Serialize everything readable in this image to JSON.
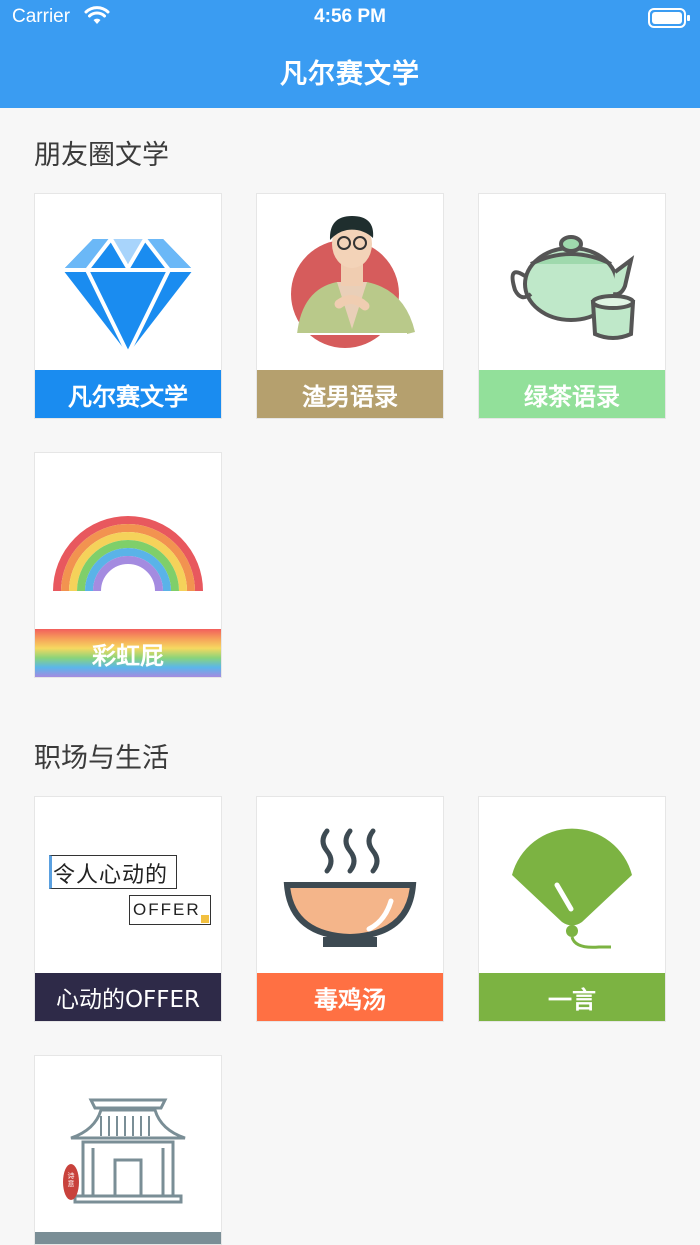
{
  "status_bar": {
    "carrier": "Carrier",
    "time": "4:56 PM"
  },
  "nav": {
    "title": "凡尔赛文学"
  },
  "sections": [
    {
      "title": "朋友圈文学",
      "items": [
        {
          "label": "凡尔赛文学",
          "icon": "diamond-icon",
          "color": "#1a8cf0"
        },
        {
          "label": "渣男语录",
          "icon": "man-illustration-icon",
          "color": "#b5a06e"
        },
        {
          "label": "绿茶语录",
          "icon": "teapot-icon",
          "color": "#92e09a"
        },
        {
          "label": "彩虹屁",
          "icon": "rainbow-icon",
          "color": "rainbow-gradient"
        }
      ]
    },
    {
      "title": "职场与生活",
      "items": [
        {
          "label": "心动的OFFER",
          "icon": "offer-logo-icon",
          "logo_text_top": "令人心动的",
          "logo_text_bottom": "OFFER",
          "color": "#2e2a48"
        },
        {
          "label": "毒鸡汤",
          "icon": "soup-bowl-icon",
          "color": "#ff7043"
        },
        {
          "label": "一言",
          "icon": "fan-icon",
          "color": "#7cb342"
        },
        {
          "label": "",
          "icon": "temple-icon",
          "seal_text": "诗意",
          "color": "#7a8e96"
        }
      ]
    }
  ]
}
